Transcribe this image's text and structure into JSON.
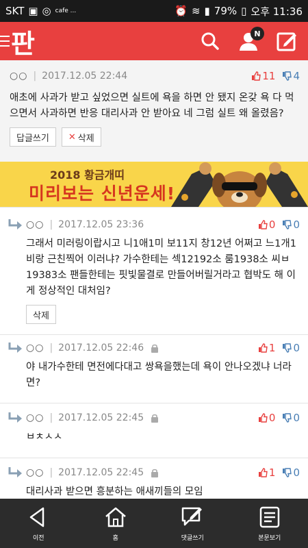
{
  "status_bar": {
    "carrier": "SKT",
    "extra": "cafe ...",
    "battery": "79%",
    "time": "오후 11:36"
  },
  "header": {
    "logo": "판",
    "notification_badge": "N"
  },
  "original_comment": {
    "author": "○○",
    "date": "2017.12.05 22:44",
    "likes": "11",
    "dislikes": "4",
    "text": "애초에 사과가 받고 싶었으면 실트에 욕을 하면 안 됐지 온갖 욕 다 먹으면서 사과하면 반응 대리사과 안 받아요 네 그럼 실트 왜 올렸음?",
    "reply_button": "답글쓰기",
    "delete_button": "삭제"
  },
  "banner": {
    "line1": "2018 황금개띠",
    "line2": "미리보는 신년운세!"
  },
  "replies": [
    {
      "author": "○○",
      "date": "2017.12.05 23:36",
      "likes": "0",
      "dislikes": "0",
      "text": "그래서 미러링이랍시고 니1애1미 보11지 창12년 어쩌고 느1개1비랑 근친찍어 이러냐? 가수한테는 섹12192소 룸1938소 씨ㅂ19383소 팬들한테는 핏빛물결로 만들어버릴거라고 협박도 해 이게 정상적인 대처임?",
      "delete_button": "삭제"
    },
    {
      "author": "○○",
      "date": "2017.12.05 22:46",
      "likes": "1",
      "dislikes": "0",
      "text": "야 내가수한테 면전에다대고 쌍욕을했는데 욕이 안나오겠냐 너라면?"
    },
    {
      "author": "○○",
      "date": "2017.12.05 22:45",
      "likes": "0",
      "dislikes": "0",
      "text": "ㅂㅊㅅㅅ"
    },
    {
      "author": "○○",
      "date": "2017.12.05 22:45",
      "likes": "1",
      "dislikes": "0",
      "text": "대리사과 받으면 흥분하는 애새끼들의 모임"
    }
  ],
  "bottom_nav": {
    "prev": "이전",
    "home": "홈",
    "write_reply": "댓글쓰기",
    "view_post": "본문보기"
  },
  "colors": {
    "brand_red": "#e8403f",
    "dislike_blue": "#4a7fb5",
    "banner_yellow": "#f9d54a"
  }
}
